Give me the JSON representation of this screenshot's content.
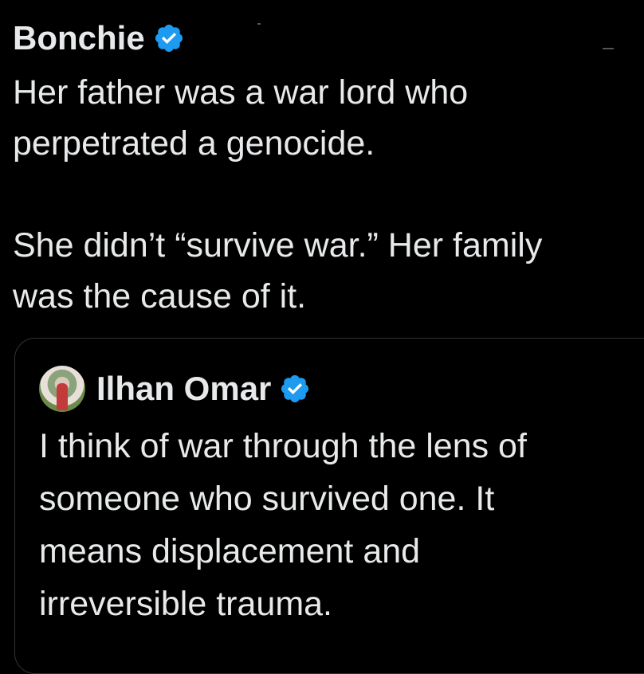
{
  "tweet": {
    "author_name": "Bonchie",
    "verified_icon": "verified-badge-icon",
    "lines": [
      "Her father was a war lord who",
      "perpetrated a genocide.",
      "",
      "She didn’t “survive war.” Her family",
      "was the cause of it."
    ]
  },
  "quoted_tweet": {
    "author_name": "Ilhan Omar",
    "verified_icon": "verified-badge-icon",
    "lines": [
      "I think of war through the lens of",
      "someone who survived one. It",
      "means displacement and",
      "irreversible trauma."
    ]
  },
  "colors": {
    "background": "#000000",
    "text": "#e7e9ea",
    "verified_blue": "#1d9bf0",
    "card_border": "#2f3336"
  }
}
